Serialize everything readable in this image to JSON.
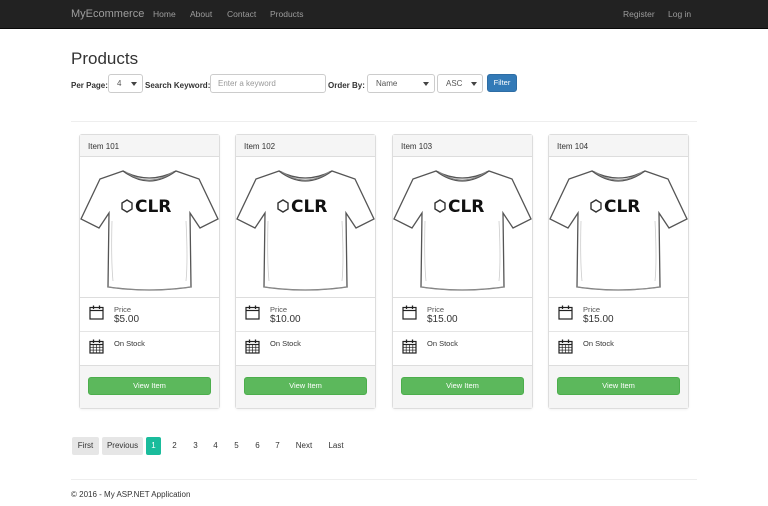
{
  "navbar": {
    "brand": "MyEcommerce",
    "links": [
      "Home",
      "About",
      "Contact",
      "Products"
    ],
    "right_links": [
      "Register",
      "Log in"
    ]
  },
  "page": {
    "title": "Products"
  },
  "filters": {
    "per_page_label": "Per Page:",
    "per_page_value": "4",
    "search_label": "Search Keyword:",
    "search_placeholder": "Enter a keyword",
    "order_by_label": "Order By:",
    "order_by_value": "Name",
    "direction_value": "ASC",
    "filter_button": "Filter"
  },
  "products": [
    {
      "name": "Item 101",
      "price_label": "Price",
      "price": "$5.00",
      "stock": "On Stock",
      "button": "View Item",
      "logo_text": "CLR"
    },
    {
      "name": "Item 102",
      "price_label": "Price",
      "price": "$10.00",
      "stock": "On Stock",
      "button": "View Item",
      "logo_text": "CLR"
    },
    {
      "name": "Item 103",
      "price_label": "Price",
      "price": "$15.00",
      "stock": "On Stock",
      "button": "View Item",
      "logo_text": "CLR"
    },
    {
      "name": "Item 104",
      "price_label": "Price",
      "price": "$15.00",
      "stock": "On Stock",
      "button": "View Item",
      "logo_text": "CLR"
    }
  ],
  "pagination": {
    "first": "First",
    "previous": "Previous",
    "pages": [
      "1",
      "2",
      "3",
      "4",
      "5",
      "6",
      "7"
    ],
    "active_page": "1",
    "next": "Next",
    "last": "Last"
  },
  "footer": {
    "text": "© 2016 - My ASP.NET Application"
  },
  "colors": {
    "navbar": "#222222",
    "primary": "#337ab7",
    "success": "#5cb85c",
    "active_page": "#1abc9c"
  }
}
